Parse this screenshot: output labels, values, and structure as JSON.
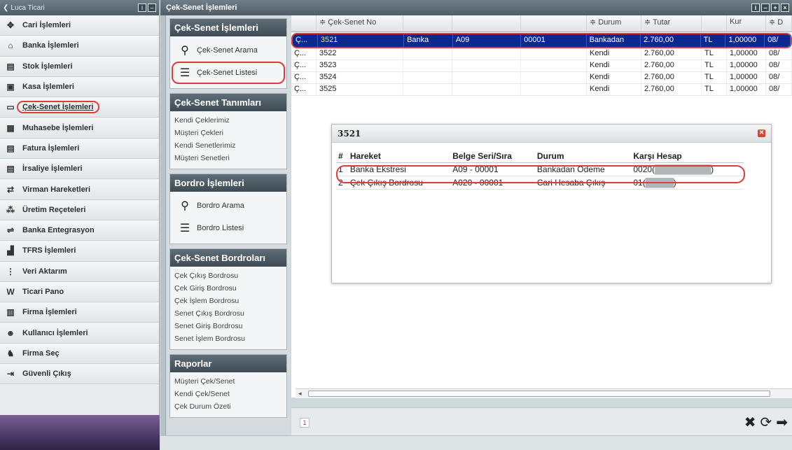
{
  "left_nav": {
    "title": "Luca Ticari",
    "items": [
      {
        "label": "Cari İşlemleri",
        "icon": "handshake-icon",
        "glyph": "✥"
      },
      {
        "label": "Banka İşlemleri",
        "icon": "bank-icon",
        "glyph": "⌂"
      },
      {
        "label": "Stok İşlemleri",
        "icon": "stock-icon",
        "glyph": "▤"
      },
      {
        "label": "Kasa İşlemleri",
        "icon": "cashbox-icon",
        "glyph": "▣"
      },
      {
        "label": "Çek-Senet İşlemleri",
        "icon": "cheque-icon",
        "glyph": "▭",
        "active": true
      },
      {
        "label": "Muhasebe İşlemleri",
        "icon": "accounting-icon",
        "glyph": "▦"
      },
      {
        "label": "Fatura İşlemleri",
        "icon": "invoice-icon",
        "glyph": "▤"
      },
      {
        "label": "İrsaliye İşlemleri",
        "icon": "waybill-icon",
        "glyph": "▤"
      },
      {
        "label": "Virman Hareketleri",
        "icon": "transfer-icon",
        "glyph": "⇄"
      },
      {
        "label": "Üretim Reçeteleri",
        "icon": "production-icon",
        "glyph": "⁂"
      },
      {
        "label": "Banka Entegrasyon",
        "icon": "integration-icon",
        "glyph": "⇌"
      },
      {
        "label": "TFRS İşlemleri",
        "icon": "tfrs-icon",
        "glyph": "▟"
      },
      {
        "label": "Veri Aktarım",
        "icon": "data-transfer-icon",
        "glyph": "⋮"
      },
      {
        "label": "Ticari Pano",
        "icon": "dashboard-icon",
        "glyph": "W"
      },
      {
        "label": "Firma İşlemleri",
        "icon": "company-icon",
        "glyph": "▥"
      },
      {
        "label": "Kullanıcı İşlemleri",
        "icon": "user-icon",
        "glyph": "☻"
      },
      {
        "label": "Firma Seç",
        "icon": "select-company-icon",
        "glyph": "♞"
      },
      {
        "label": "Güvenli Çıkış",
        "icon": "logout-icon",
        "glyph": "⇥"
      }
    ]
  },
  "topbar": {
    "title": "Çek-Senet İşlemleri"
  },
  "mid": {
    "cek_senet_islemleri": {
      "title": "Çek-Senet İşlemleri",
      "links": [
        {
          "label": "Çek-Senet Arama",
          "icon": "search-icon",
          "glyph": "⚲"
        },
        {
          "label": "Çek-Senet Listesi",
          "icon": "list-icon",
          "glyph": "☰",
          "circled": true
        }
      ]
    },
    "tanimlar": {
      "title": "Çek-Senet Tanımları",
      "links": [
        "Kendi Çeklerimiz",
        "Müşteri Çekleri",
        "Kendi Senetlerimiz",
        "Müşteri Senetleri"
      ]
    },
    "bordro_islemleri": {
      "title": "Bordro İşlemleri",
      "links": [
        {
          "label": "Bordro Arama",
          "icon": "search-icon",
          "glyph": "⚲"
        },
        {
          "label": "Bordro Listesi",
          "icon": "list-icon",
          "glyph": "☰"
        }
      ]
    },
    "bordrolar": {
      "title": "Çek-Senet Bordroları",
      "links": [
        "Çek Çıkış Bordrosu",
        "Çek Giriş Bordrosu",
        "Çek İşlem Bordrosu",
        "Senet Çıkış Bordrosu",
        "Senet Giriş Bordrosu",
        "Senet İşlem Bordrosu"
      ]
    },
    "raporlar": {
      "title": "Raporlar",
      "links": [
        "Müşteri Çek/Senet",
        "Kendi Çek/Senet",
        "Çek Durum Özeti"
      ]
    }
  },
  "grid": {
    "headers": [
      "",
      "≑ Çek-Senet No",
      "",
      "",
      "",
      "≑ Durum",
      "≑ Tutar",
      "",
      "Kur",
      "≑ D"
    ],
    "rows": [
      [
        "Ç...",
        "3521",
        "Banka",
        "A09",
        "00001",
        "Bankadan",
        "2.760,00",
        "TL",
        "1,00000",
        "08/"
      ],
      [
        "Ç...",
        "3522",
        "",
        "",
        "",
        "Kendi",
        "2.760,00",
        "TL",
        "1,00000",
        "08/"
      ],
      [
        "Ç...",
        "3523",
        "",
        "",
        "",
        "Kendi",
        "2.760,00",
        "TL",
        "1,00000",
        "08/"
      ],
      [
        "Ç...",
        "3524",
        "",
        "",
        "",
        "Kendi",
        "2.760,00",
        "TL",
        "1,00000",
        "08/"
      ],
      [
        "Ç...",
        "3525",
        "",
        "",
        "",
        "Kendi",
        "2.760,00",
        "TL",
        "1,00000",
        "08/"
      ]
    ]
  },
  "popup": {
    "title": "3521",
    "headers": [
      "#",
      "Hareket",
      "Belge Seri/Sıra",
      "Durum",
      "Karşı Hesap"
    ],
    "rows": [
      [
        "1",
        "Banka Ekstresi",
        "A09 - 00001",
        "Bankadan Ödeme",
        "0020(",
        "██████████",
        ")"
      ],
      [
        "2",
        "Çek Çıkış Bordrosu",
        "A020 - 00001",
        "Cari Hesaba Çıkış",
        "01(",
        "█████",
        ")"
      ]
    ]
  },
  "status": {
    "page": "1"
  },
  "colors": {
    "selection": "#0a2a8f",
    "highlight_circle": "#e23a3a"
  }
}
